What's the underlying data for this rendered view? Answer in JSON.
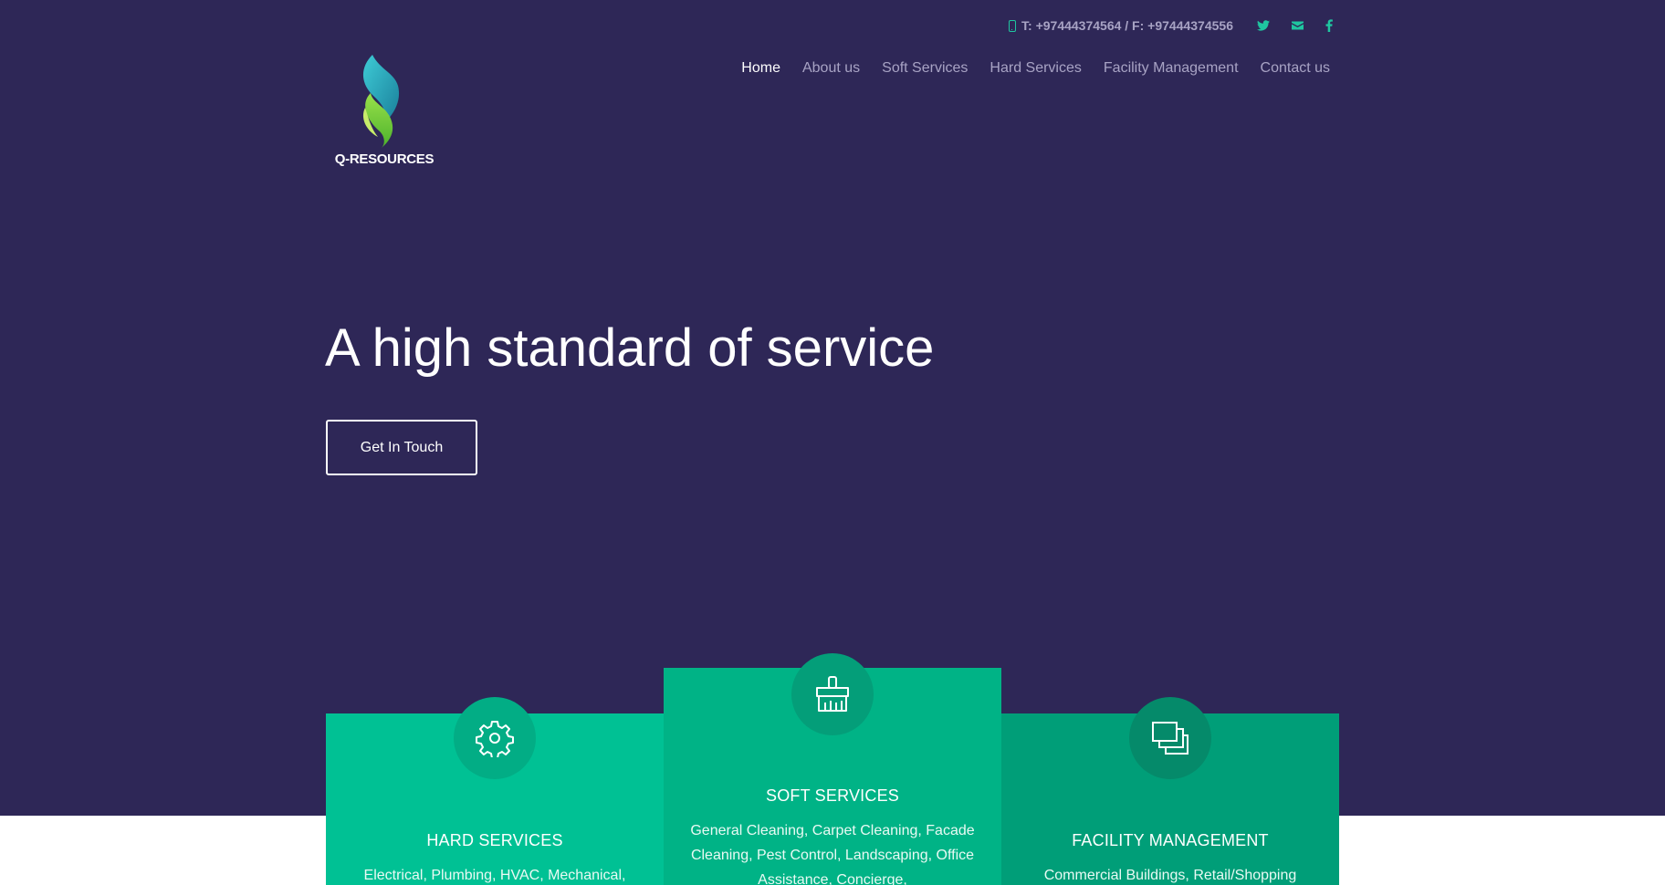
{
  "colors": {
    "hero_bg": "#2e2757",
    "accent": "#1fc6a0",
    "card_light": "#00c194",
    "card_mid": "#00b386",
    "card_dark": "#009e78"
  },
  "topbar": {
    "contact_text": "T: +97444374564 / F: +97444374556",
    "phone_icon": "mobile-phone-icon",
    "social_icons": [
      "twitter-icon",
      "email-icon",
      "facebook-icon"
    ]
  },
  "logo": {
    "text": "Q-RESOURCES"
  },
  "nav": {
    "items": [
      {
        "label": "Home"
      },
      {
        "label": "About us"
      },
      {
        "label": "Soft Services"
      },
      {
        "label": "Hard Services"
      },
      {
        "label": "Facility Management"
      },
      {
        "label": "Contact us"
      }
    ]
  },
  "hero": {
    "headline": "A high standard of service",
    "cta_label": "Get In Touch"
  },
  "services": [
    {
      "title": "HARD SERVICES",
      "icon": "gear-icon",
      "description": "Electrical, Plumbing, HVAC, Mechanical,"
    },
    {
      "title": "SOFT SERVICES",
      "icon": "cleaning-brush-icon",
      "description": "General Cleaning, Carpet Cleaning, Facade Cleaning, Pest Control, Landscaping, Office Assistance, Concierge,"
    },
    {
      "title": "FACILITY MANAGEMENT",
      "icon": "stacked-screens-icon",
      "description": "Commercial Buildings, Retail/Shopping"
    }
  ]
}
